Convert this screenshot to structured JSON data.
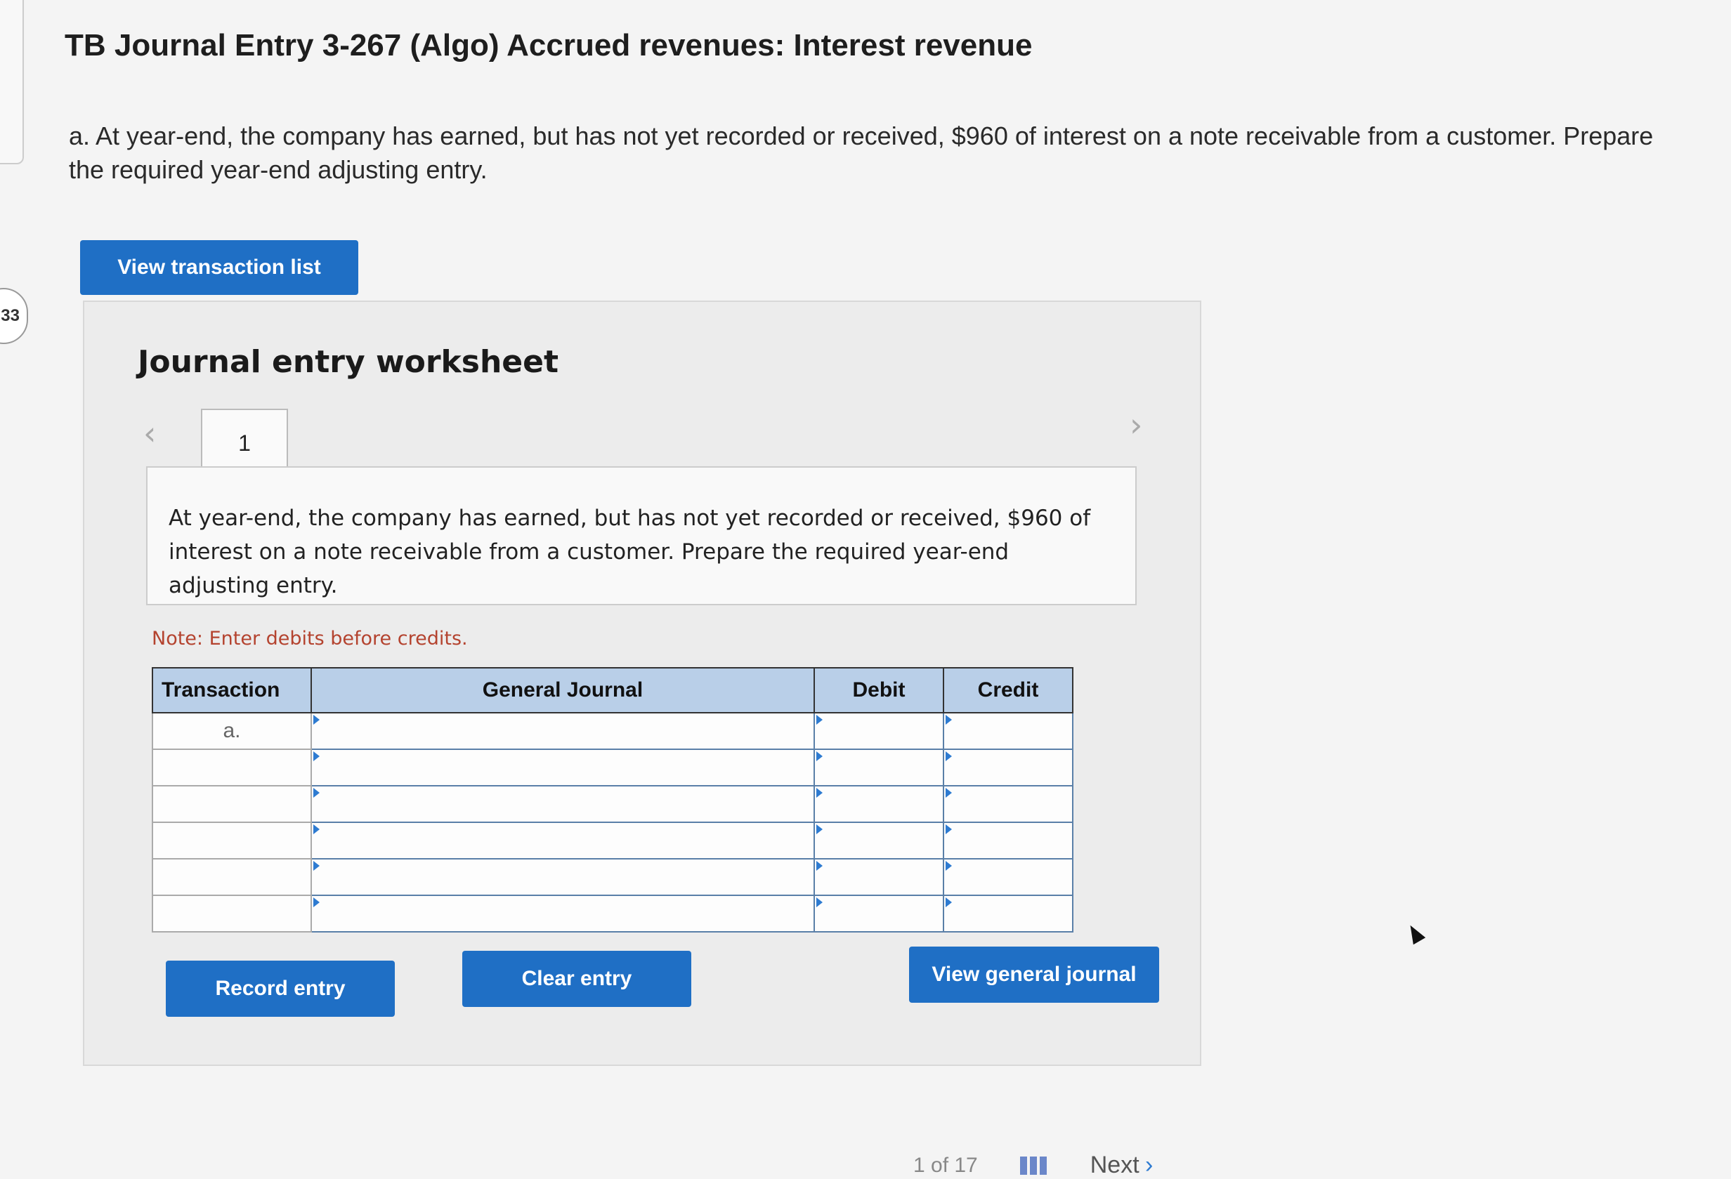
{
  "side_badge": "33",
  "title": "TB Journal Entry 3-267 (Algo) Accrued revenues: Interest revenue",
  "question": "a. At year-end, the company has earned, but has not yet recorded or received, $960 of interest on a note receivable from a customer. Prepare the required year-end adjusting entry.",
  "buttons": {
    "view_transaction_list": "View transaction list",
    "record_entry": "Record entry",
    "clear_entry": "Clear entry",
    "view_general_journal": "View general journal"
  },
  "worksheet": {
    "title": "Journal entry worksheet",
    "prev_icon": "chevron-left-icon",
    "next_icon": "chevron-right-icon",
    "tab_label": "1",
    "description": "At year-end, the company has earned, but has not yet recorded or received, $960 of interest on a note receivable from a customer. Prepare the required year-end adjusting entry.",
    "note": "Note: Enter debits before credits.",
    "columns": [
      "Transaction",
      "General Journal",
      "Debit",
      "Credit"
    ],
    "rows": [
      {
        "transaction": "a.",
        "general_journal": "",
        "debit": "",
        "credit": ""
      },
      {
        "transaction": "",
        "general_journal": "",
        "debit": "",
        "credit": ""
      },
      {
        "transaction": "",
        "general_journal": "",
        "debit": "",
        "credit": ""
      },
      {
        "transaction": "",
        "general_journal": "",
        "debit": "",
        "credit": ""
      },
      {
        "transaction": "",
        "general_journal": "",
        "debit": "",
        "credit": ""
      },
      {
        "transaction": "",
        "general_journal": "",
        "debit": "",
        "credit": ""
      }
    ]
  },
  "footer": {
    "page_indicator": "1 of 17",
    "next_label": "Next",
    "next_icon": "chevron-right-icon",
    "grid_icon": "grid-icon"
  },
  "colors": {
    "accent_button": "#1f6fc5",
    "table_header": "#b9cfe8",
    "note_text": "#b4432f"
  }
}
